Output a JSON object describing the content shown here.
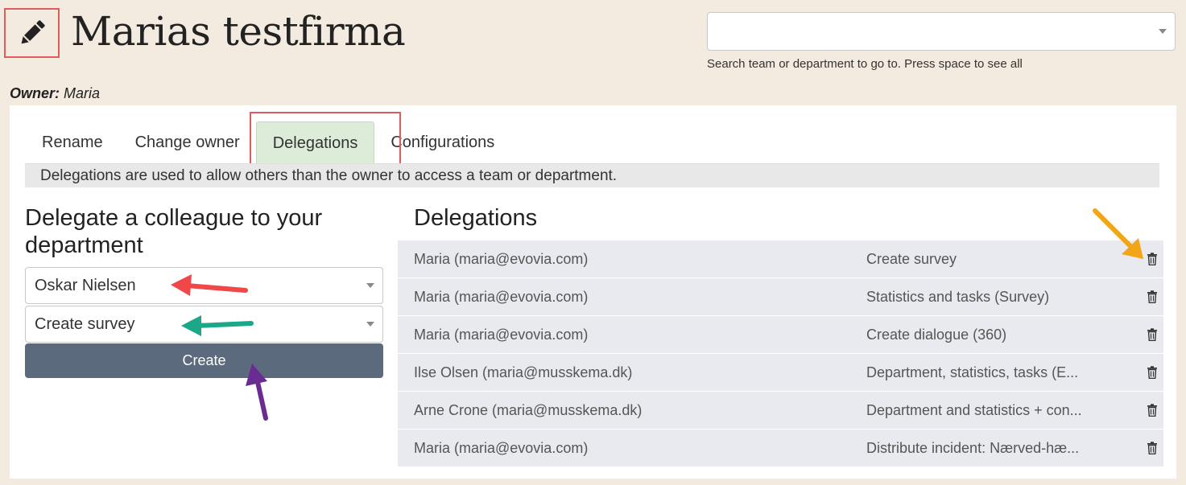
{
  "header": {
    "edit_icon": "pencil-icon",
    "title": "Marias testfirma",
    "search": {
      "value": "",
      "hint": "Search team or department to go to. Press space to see all"
    },
    "owner_label": "Owner:",
    "owner_name": "Maria"
  },
  "tabs": [
    {
      "label": "Rename",
      "active": false
    },
    {
      "label": "Change owner",
      "active": false
    },
    {
      "label": "Delegations",
      "active": true
    },
    {
      "label": "Configurations",
      "active": false
    }
  ],
  "info_text": "Delegations are used to allow others than the owner to access a team or department.",
  "form": {
    "heading": "Delegate a colleague to your department",
    "colleague_value": "Oskar Nielsen",
    "permission_value": "Create survey",
    "create_label": "Create"
  },
  "delegations": {
    "heading": "Delegations",
    "rows": [
      {
        "name": "Maria (maria@evovia.com)",
        "permission": "Create survey"
      },
      {
        "name": "Maria (maria@evovia.com)",
        "permission": "Statistics and tasks (Survey)"
      },
      {
        "name": "Maria (maria@evovia.com)",
        "permission": "Create dialogue (360)"
      },
      {
        "name": "Ilse Olsen (maria@musskema.dk)",
        "permission": "Department, statistics, tasks (E..."
      },
      {
        "name": "Arne Crone (maria@musskema.dk)",
        "permission": "Department and statistics + con..."
      },
      {
        "name": "Maria (maria@evovia.com)",
        "permission": "Distribute incident: Nærved-hæ..."
      }
    ]
  },
  "colors": {
    "background": "#f4ebe0",
    "active_tab": "#ddebd9",
    "create_button": "#5b6b7d",
    "highlight_red": "#e05b5b",
    "arrow_red": "#f04848",
    "arrow_green": "#1aa889",
    "arrow_purple": "#6a2c91",
    "arrow_orange": "#f2a516"
  }
}
